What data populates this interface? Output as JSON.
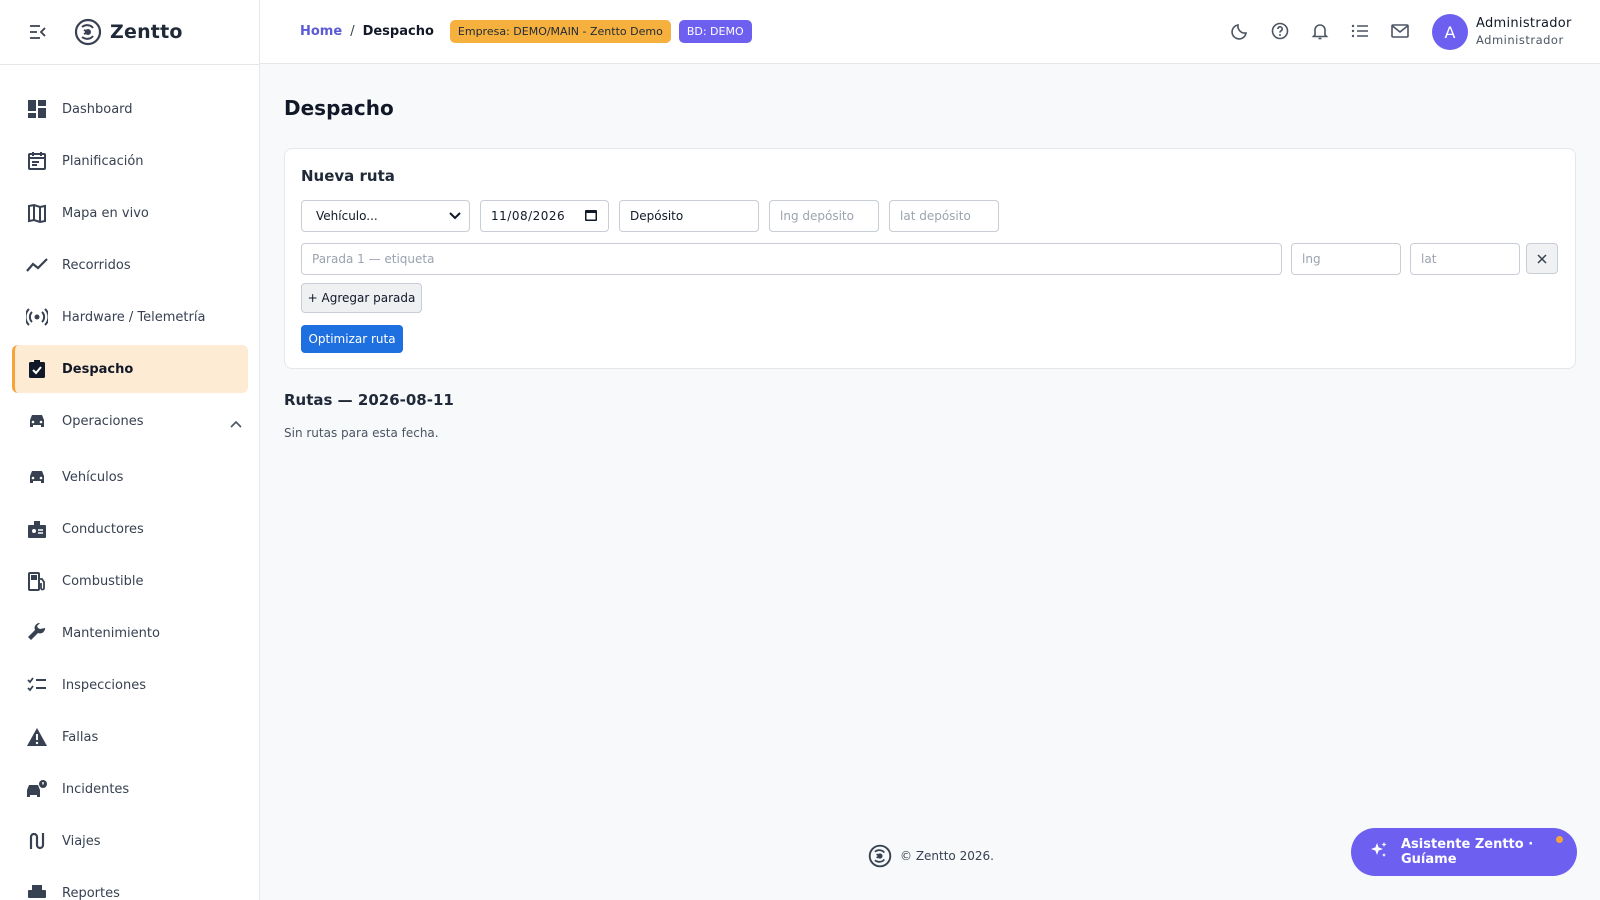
{
  "app": {
    "name": "Zentto"
  },
  "sidebar": {
    "items": [
      {
        "label": "Dashboard",
        "icon": "dashboard-icon"
      },
      {
        "label": "Planificación",
        "icon": "calendar-icon"
      },
      {
        "label": "Mapa en vivo",
        "icon": "map-icon"
      },
      {
        "label": "Recorridos",
        "icon": "trending-line-icon"
      },
      {
        "label": "Hardware / Telemetría",
        "icon": "broadcast-icon"
      },
      {
        "label": "Despacho",
        "icon": "clipboard-check-icon",
        "active": true
      },
      {
        "label": "Operaciones",
        "icon": "car-icon",
        "expanded": true
      },
      {
        "label": "Vehículos",
        "icon": "car-icon"
      },
      {
        "label": "Conductores",
        "icon": "badge-icon"
      },
      {
        "label": "Combustible",
        "icon": "fuel-pump-icon"
      },
      {
        "label": "Mantenimiento",
        "icon": "wrench-icon"
      },
      {
        "label": "Inspecciones",
        "icon": "checklist-icon"
      },
      {
        "label": "Fallas",
        "icon": "warning-icon"
      },
      {
        "label": "Incidentes",
        "icon": "car-alert-icon"
      },
      {
        "label": "Viajes",
        "icon": "route-icon"
      },
      {
        "label": "Reportes",
        "icon": "printer-icon"
      }
    ]
  },
  "header": {
    "breadcrumb": {
      "home": "Home",
      "separator": "/",
      "current": "Despacho"
    },
    "badge_empresa": "Empresa: DEMO/MAIN - Zentto Demo",
    "badge_bd": "BD: DEMO",
    "icons": [
      "moon-icon",
      "help-icon",
      "bell-icon",
      "list-icon",
      "mail-icon"
    ],
    "user": {
      "initial": "A",
      "name": "Administrador",
      "role": "Administrador"
    }
  },
  "main": {
    "title": "Despacho",
    "form": {
      "title": "Nueva ruta",
      "vehicle_select": "Vehículo...",
      "date": "11/08/2026",
      "deposit_label": "Depósito",
      "lng_deposit_placeholder": "lng depósito",
      "lat_deposit_placeholder": "lat depósito",
      "stop_label_placeholder": "Parada 1 — etiqueta",
      "stop_lng_placeholder": "lng",
      "stop_lat_placeholder": "lat",
      "add_stop_button": "+ Agregar parada",
      "optimize_button": "Optimizar ruta"
    },
    "routes": {
      "title": "Rutas — 2026-08-11",
      "empty": "Sin rutas para esta fecha."
    }
  },
  "footer": {
    "text": "© Zentto 2026."
  },
  "assistant": {
    "label": "Asistente Zentto · Guíame"
  },
  "colors": {
    "accent": "#6d5ff0",
    "active_bg": "#fdebd3",
    "active_border": "#f6a43a",
    "primary_button": "#1e6fe0",
    "empresa_badge": "#f6b03e"
  }
}
